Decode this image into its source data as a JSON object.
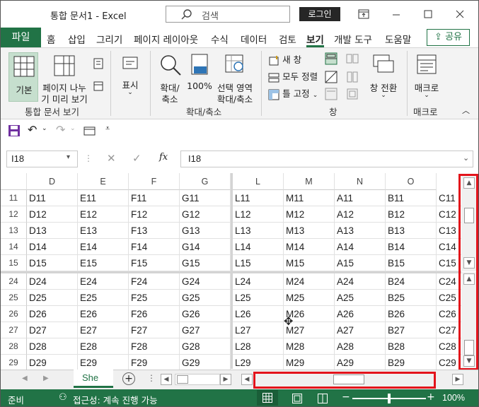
{
  "titlebar": {
    "title": "통합 문서1 - Excel",
    "search_placeholder": "검색",
    "login_label": "로그인"
  },
  "tabs": {
    "file": "파일",
    "items": [
      "홈",
      "삽입",
      "그리기",
      "페이지 레이아웃",
      "수식",
      "데이터",
      "검토",
      "보기",
      "개발 도구",
      "도움말"
    ],
    "active": "보기",
    "share": "공유"
  },
  "ribbon": {
    "normal": "기본",
    "page_break": [
      "페이지 나누",
      "기 미리 보기"
    ],
    "show": "표시",
    "zoom": [
      "확대/",
      "축소"
    ],
    "zoom100": "100%",
    "zoom_selection": [
      "선택 영역",
      "확대/축소"
    ],
    "new_window": "새 창",
    "arrange_all": "모두 정렬",
    "freeze_panes": "틀 고정",
    "switch_windows": "창 전환",
    "macros": "매크로",
    "groups": {
      "workbook_views": "통합 문서 보기",
      "zoom": "확대/축소",
      "window": "창",
      "macros": "매크로"
    }
  },
  "formula_bar": {
    "name_box": "I18",
    "formula": "I18",
    "fx": "fx"
  },
  "grid": {
    "left_columns": [
      "D",
      "E",
      "F",
      "G"
    ],
    "right_columns": [
      "L",
      "M",
      "N",
      "O"
    ],
    "top_rows": [
      {
        "row": "11",
        "left": [
          "D11",
          "E11",
          "F11",
          "G11"
        ],
        "right": [
          "L11",
          "M11",
          "A11",
          "B11",
          "C11"
        ]
      },
      {
        "row": "12",
        "left": [
          "D12",
          "E12",
          "F12",
          "G12"
        ],
        "right": [
          "L12",
          "M12",
          "A12",
          "B12",
          "C12"
        ]
      },
      {
        "row": "13",
        "left": [
          "D13",
          "E13",
          "F13",
          "G13"
        ],
        "right": [
          "L13",
          "M13",
          "A13",
          "B13",
          "C13"
        ]
      },
      {
        "row": "14",
        "left": [
          "D14",
          "E14",
          "F14",
          "G14"
        ],
        "right": [
          "L14",
          "M14",
          "A14",
          "B14",
          "C14"
        ]
      },
      {
        "row": "15",
        "left": [
          "D15",
          "E15",
          "F15",
          "G15"
        ],
        "right": [
          "L15",
          "M15",
          "A15",
          "B15",
          "C15"
        ]
      }
    ],
    "bottom_rows": [
      {
        "row": "24",
        "left": [
          "D24",
          "E24",
          "F24",
          "G24"
        ],
        "right": [
          "L24",
          "M24",
          "A24",
          "B24",
          "C24"
        ]
      },
      {
        "row": "25",
        "left": [
          "D25",
          "E25",
          "F25",
          "G25"
        ],
        "right": [
          "L25",
          "M25",
          "A25",
          "B25",
          "C25"
        ]
      },
      {
        "row": "26",
        "left": [
          "D26",
          "E26",
          "F26",
          "G26"
        ],
        "right": [
          "L26",
          "M26",
          "A26",
          "B26",
          "C26"
        ]
      },
      {
        "row": "27",
        "left": [
          "D27",
          "E27",
          "F27",
          "G27"
        ],
        "right": [
          "L27",
          "M27",
          "A27",
          "B27",
          "C27"
        ]
      },
      {
        "row": "28",
        "left": [
          "D28",
          "E28",
          "F28",
          "G28"
        ],
        "right": [
          "L28",
          "M28",
          "A28",
          "B28",
          "C28"
        ]
      },
      {
        "row": "29",
        "left": [
          "D29",
          "E29",
          "F29",
          "G29"
        ],
        "right": [
          "L29",
          "M29",
          "A29",
          "B29",
          "C29"
        ]
      }
    ]
  },
  "sheet_tab": "She",
  "status": {
    "ready": "준비",
    "accessibility": "접근성: 계속 진행 가능",
    "zoom": "100%"
  },
  "colors": {
    "excel_green": "#217346",
    "highlight_red": "#e3131b"
  }
}
